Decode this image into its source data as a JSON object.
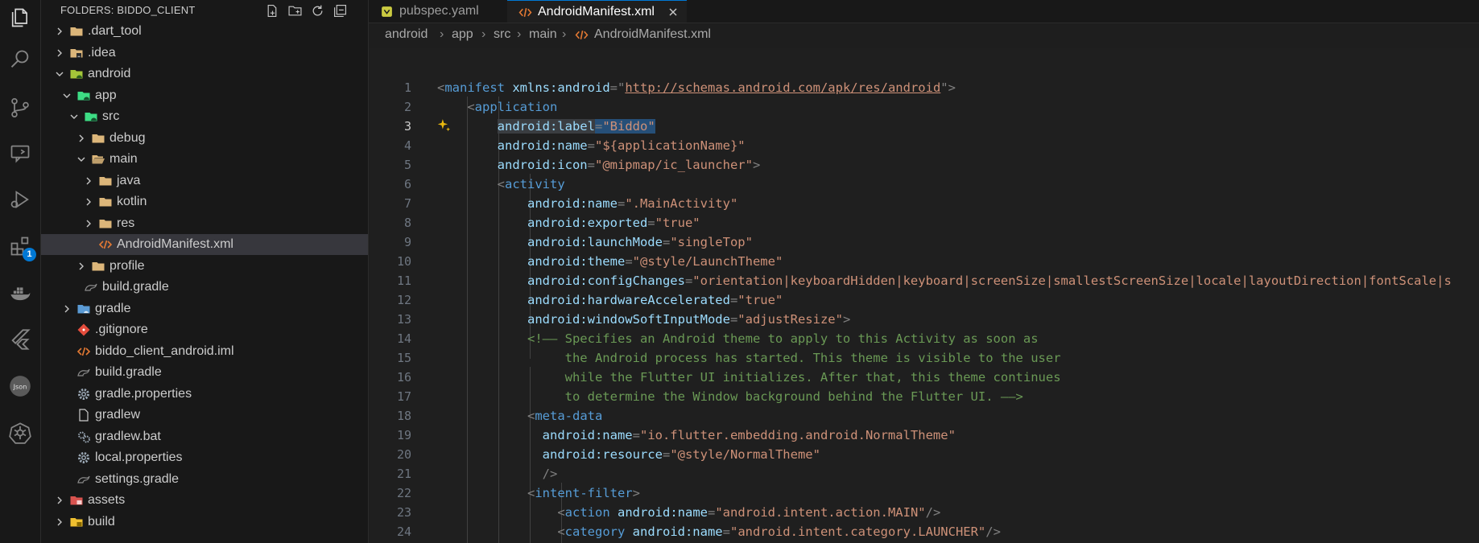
{
  "activity_bar": {
    "icons": [
      "explorer-icon",
      "search-icon",
      "source-control-icon",
      "remote-explorer-icon",
      "run-debug-icon",
      "extensions-icon",
      "docker-icon",
      "flutter-icon",
      "json-icon",
      "kubernetes-icon"
    ],
    "extensions_badge": "1"
  },
  "sidebar": {
    "title": "FOLDERS: BIDDO_CLIENT",
    "items": [
      {
        "label": ".dart_tool"
      },
      {
        "label": ".idea"
      },
      {
        "label": "android"
      },
      {
        "label": "app"
      },
      {
        "label": "src"
      },
      {
        "label": "debug"
      },
      {
        "label": "main"
      },
      {
        "label": "java"
      },
      {
        "label": "kotlin"
      },
      {
        "label": "res"
      },
      {
        "label": "AndroidManifest.xml"
      },
      {
        "label": "profile"
      },
      {
        "label": "build.gradle"
      },
      {
        "label": "gradle"
      },
      {
        "label": ".gitignore"
      },
      {
        "label": "biddo_client_android.iml"
      },
      {
        "label": "build.gradle"
      },
      {
        "label": "gradle.properties"
      },
      {
        "label": "gradlew"
      },
      {
        "label": "gradlew.bat"
      },
      {
        "label": "local.properties"
      },
      {
        "label": "settings.gradle"
      },
      {
        "label": "assets"
      },
      {
        "label": "build"
      }
    ]
  },
  "tabs": [
    {
      "label": "pubspec.yaml",
      "active": false
    },
    {
      "label": "AndroidManifest.xml",
      "active": true
    }
  ],
  "breadcrumb": [
    "android",
    "app",
    "src",
    "main",
    "AndroidManifest.xml"
  ],
  "editor": {
    "current_line": 3,
    "line_numbers": [
      "1",
      "2",
      "3",
      "4",
      "5",
      "6",
      "7",
      "8",
      "9",
      "10",
      "11",
      "12",
      "13",
      "14",
      "15",
      "16",
      "17",
      "18",
      "19",
      "20",
      "21",
      "22",
      "23",
      "24"
    ],
    "lines": {
      "l1_tag": "manifest",
      "l1_attr": "xmlns:android",
      "l1_val": "http://schemas.android.com/apk/res/android",
      "l2_tag": "application",
      "l3_attr_a": "android:label",
      "l3_val": "\"Biddo\"",
      "l4_attr": "android:name",
      "l4_val": "\"${applicationName}\"",
      "l5_attr": "android:icon",
      "l5_val": "\"@mipmap/ic_launcher\"",
      "l6_tag": "activity",
      "l7_attr": "android:name",
      "l7_val": "\".MainActivity\"",
      "l8_attr": "android:exported",
      "l8_val": "\"true\"",
      "l9_attr": "android:launchMode",
      "l9_val": "\"singleTop\"",
      "l10_attr": "android:theme",
      "l10_val": "\"@style/LaunchTheme\"",
      "l11_attr": "android:configChanges",
      "l11_val": "\"orientation|keyboardHidden|keyboard|screenSize|smallestScreenSize|locale|layoutDirection|fontScale|s",
      "l12_attr": "android:hardwareAccelerated",
      "l12_val": "\"true\"",
      "l13_attr": "android:windowSoftInputMode",
      "l13_val": "\"adjustResize\"",
      "l14_com": "<!—— Specifies an Android theme to apply to this Activity as soon as",
      "l15_com": "the Android process has started. This theme is visible to the user",
      "l16_com": "while the Flutter UI initializes. After that, this theme continues",
      "l17_com": "to determine the Window background behind the Flutter UI. ——>",
      "l18_tag": "meta-data",
      "l19_attr": "android:name",
      "l19_val": "\"io.flutter.embedding.android.NormalTheme\"",
      "l20_attr": "android:resource",
      "l20_val": "\"@style/NormalTheme\"",
      "l21_punc": "/>",
      "l22_tag": "intent-filter",
      "l23_tag": "action",
      "l23_attr": "android:name",
      "l23_val": "\"android.intent.action.MAIN\"",
      "l24_tag": "category",
      "l24_attr": "android:name",
      "l24_val": "\"android.intent.category.LAUNCHER\""
    }
  },
  "colors": {
    "accent": "#0078d4",
    "tag": "#569cd6",
    "attribute": "#9cdcfe",
    "string": "#ce9178",
    "comment": "#6a9955",
    "folder": "#dcb67a",
    "xml_icon": "#e37933"
  }
}
